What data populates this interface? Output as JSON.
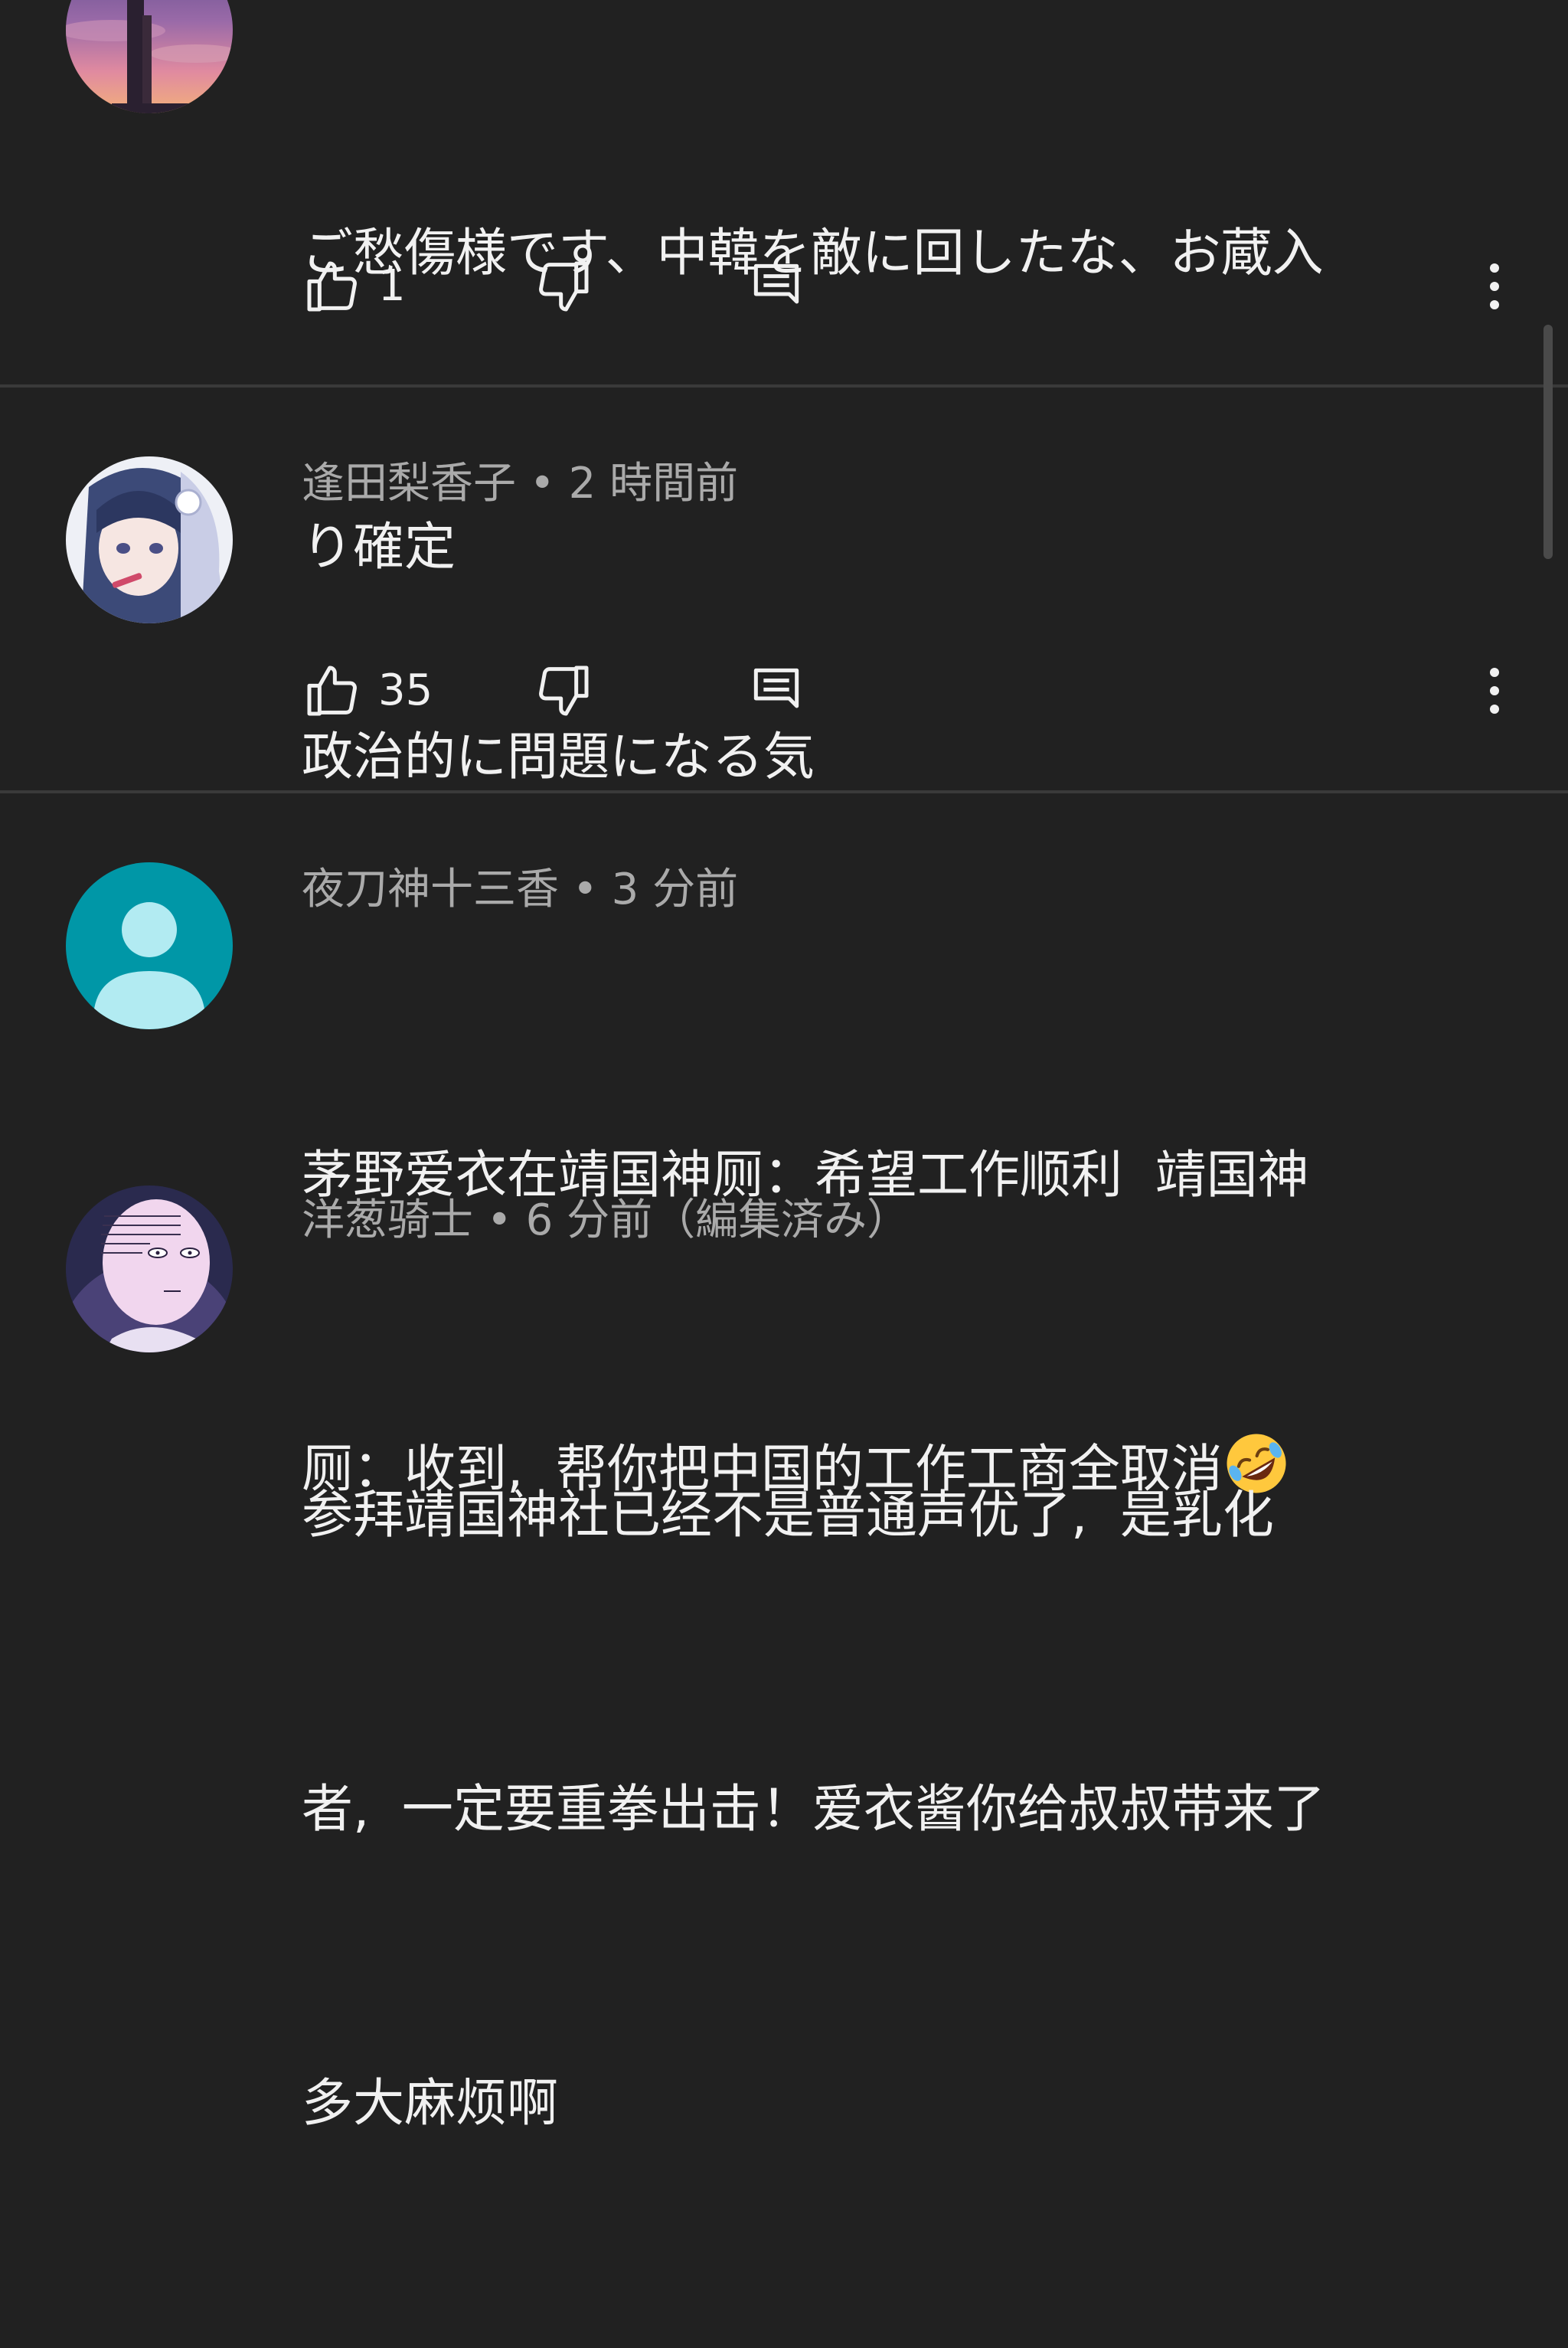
{
  "comments": [
    {
      "author": "",
      "time": "",
      "meta": "",
      "text": "ご愁傷様です、中韓を敵に回したな、お蔵入り確定",
      "line1": "ご愁傷様です、中韓を敵に回したな、お蔵入",
      "line2": "り確定",
      "likes": "1",
      "avatar_icon": "sunset-tower-avatar"
    },
    {
      "author": "逢田梨香子",
      "time": "2 時間前",
      "meta": "逢田梨香子 • 2 時間前",
      "text": "政治的に問題になる気",
      "likes": "35",
      "avatar_icon": "anime-girl-avatar"
    },
    {
      "author": "夜刀神十三香",
      "time": "3 分前",
      "meta": "夜刀神十三香 • 3 分前",
      "line1": "茅野爱衣在靖国神厕：希望工作顺利  靖国神",
      "line2": "厕：收到,  帮你把中国的工作工商全取消",
      "emoji": "rolling-on-floor-laughing-emoji",
      "avatar_icon": "default-person-avatar",
      "avatar_color": "#0097a7"
    },
    {
      "author": "洋葱骑士",
      "time": "6 分前",
      "edited": "（編集済み）",
      "meta": "洋葱骑士 • 6 分前（編集済み）",
      "line1": "参拜靖国神社已经不是普通声优了,  是乳化",
      "line2": "者,  一定要重拳出击！爱衣酱你给叔叔带来了",
      "line3": "多大麻烦啊",
      "avatar_icon": "bald-hero-avatar"
    }
  ],
  "icons": {
    "like": "thumbs-up-icon",
    "dislike": "thumbs-down-icon",
    "reply": "reply-comment-icon",
    "more": "more-vertical-icon"
  },
  "colors": {
    "background": "#212121",
    "text_primary": "#f1f1f1",
    "text_secondary": "#aaaaaa",
    "divider": "#3a3a3a"
  }
}
